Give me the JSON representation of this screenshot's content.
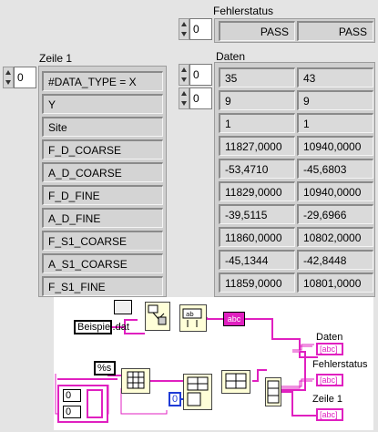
{
  "fehlerstatus": {
    "label": "Fehlerstatus",
    "index": "0",
    "values": [
      "PASS",
      "PASS"
    ]
  },
  "zeile1": {
    "label": "Zeile 1",
    "index": "0",
    "rows": [
      "#DATA_TYPE = X",
      "Y",
      "Site",
      "F_D_COARSE",
      "A_D_COARSE",
      "F_D_FINE",
      "A_D_FINE",
      "F_S1_COARSE",
      "A_S1_COARSE",
      "F_S1_FINE"
    ]
  },
  "daten": {
    "label": "Daten",
    "row_index": "0",
    "col_index": "0",
    "rows": [
      [
        "35",
        "43"
      ],
      [
        "9",
        "9"
      ],
      [
        "1",
        "1"
      ],
      [
        "11827,0000",
        "10940,0000"
      ],
      [
        "-53,4710",
        "-45,6803"
      ],
      [
        "11829,0000",
        "10940,0000"
      ],
      [
        "-39,5115",
        "-29,6966"
      ],
      [
        "11860,0000",
        "10802,0000"
      ],
      [
        "-45,1344",
        "-42,8448"
      ],
      [
        "11859,0000",
        "10801,0000"
      ]
    ]
  },
  "diagram": {
    "file_constant": "Beispiel.dat",
    "format_constant": "%s",
    "index_constant": "0",
    "cluster_values": [
      "0",
      "0"
    ],
    "string_indicator": "abc",
    "outputs": [
      {
        "label": "Daten",
        "type": "[abc]"
      },
      {
        "label": "Fehlerstatus",
        "type": "[abc]"
      },
      {
        "label": "Zeile 1",
        "type": "[abc]"
      }
    ],
    "colors": {
      "string_wire": "#e020c0",
      "numeric_wire": "#1f3cd6",
      "border": "#c9c9c9"
    }
  }
}
